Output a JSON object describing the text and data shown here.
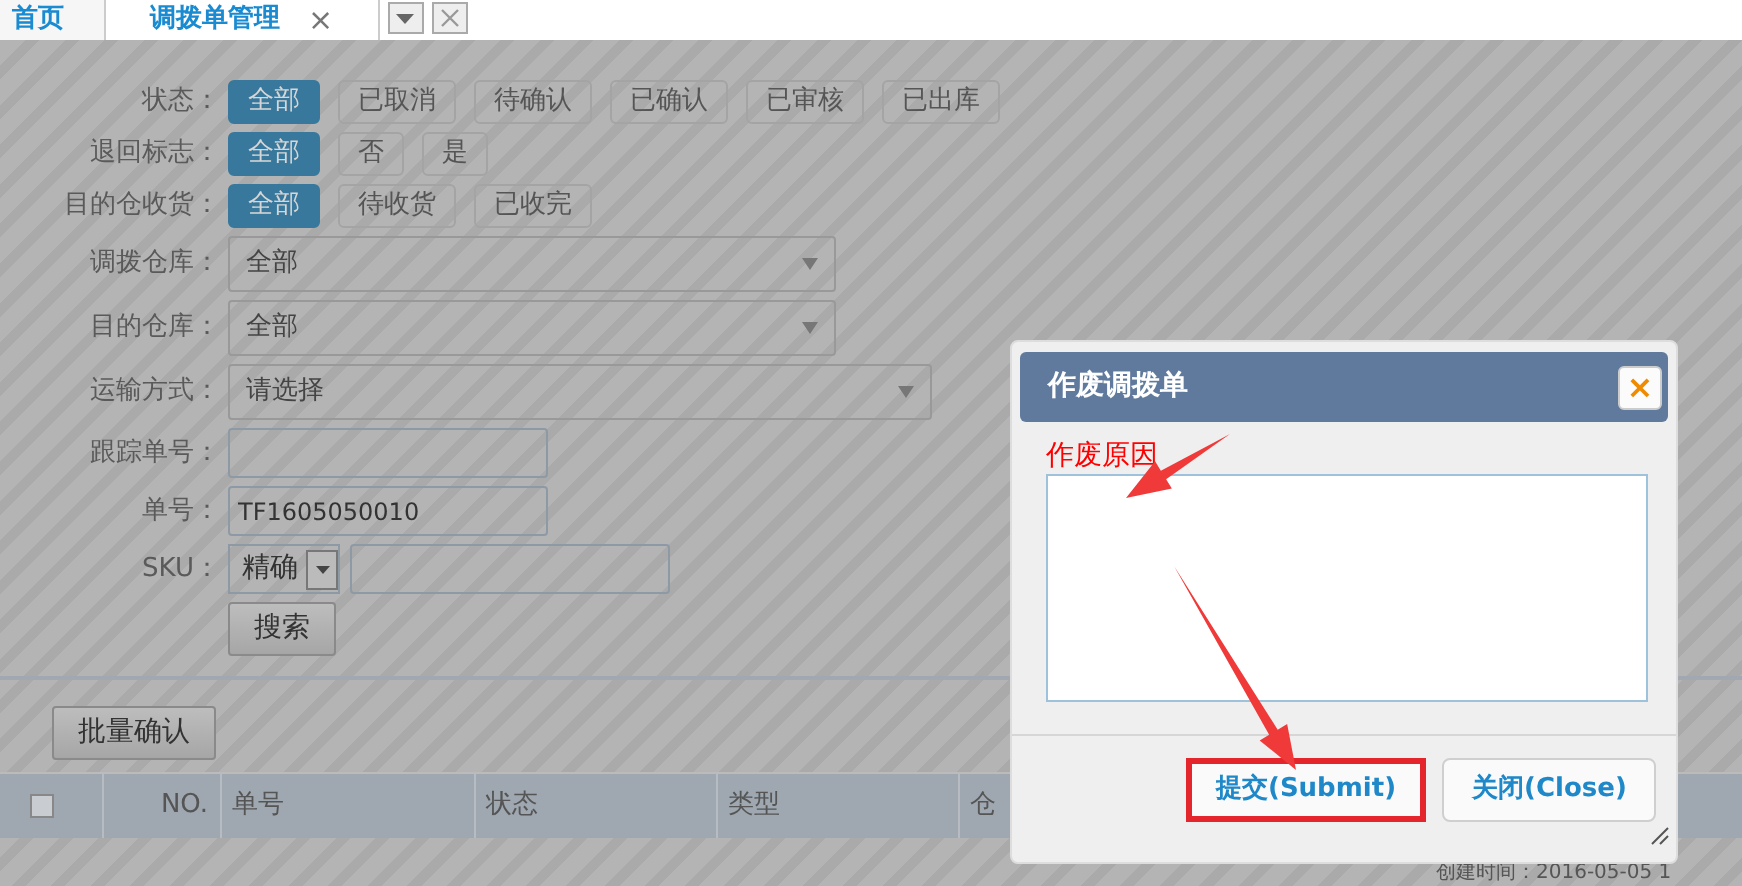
{
  "tabs": [
    {
      "label": "首页",
      "selected": false
    },
    {
      "label": "调拨单管理",
      "selected": true,
      "close": "×"
    }
  ],
  "filters": [
    {
      "kind": "choice",
      "label": "状态：",
      "options": [
        {
          "label": "全部",
          "selected": true
        },
        {
          "label": "已取消",
          "selected": false
        },
        {
          "label": "待确认",
          "selected": false
        },
        {
          "label": "已确认",
          "selected": false
        },
        {
          "label": "已审核",
          "selected": false
        },
        {
          "label": "已出库",
          "selected": false
        }
      ]
    },
    {
      "kind": "choice",
      "label": "退回标志：",
      "options": [
        {
          "label": "全部",
          "selected": true
        },
        {
          "label": "否",
          "selected": false
        },
        {
          "label": "是",
          "selected": false
        }
      ]
    },
    {
      "kind": "choice",
      "label": "目的仓收货：",
      "options": [
        {
          "label": "全部",
          "selected": true
        },
        {
          "label": "待收货",
          "selected": false
        },
        {
          "label": "已收完",
          "selected": false
        }
      ]
    },
    {
      "kind": "select",
      "label": "调拨仓库：",
      "value": "全部"
    },
    {
      "kind": "select",
      "label": "目的仓库：",
      "value": "全部"
    },
    {
      "kind": "select",
      "label": "运输方式：",
      "value": "请选择"
    },
    {
      "kind": "input",
      "label": "跟踪单号："
    },
    {
      "kind": "input",
      "label": "单号：",
      "value": "TF1605050010"
    },
    {
      "kind": "sku",
      "label": "SKU：",
      "value": "精确"
    }
  ],
  "search_button": "搜索",
  "batch_button": "批量确认",
  "table": {
    "header_checkbox": {
      "checked": false
    },
    "columns": [
      "NO.",
      "单号",
      "状态",
      "类型",
      "仓"
    ]
  },
  "footer_text": "创建时间：2016-05-05 1",
  "dialog": {
    "title": "作废调拨单",
    "close": "×",
    "field_label": "作废原因",
    "buttons": [
      {
        "label": "提交(Submit)",
        "highlighted": true
      },
      {
        "label": "关闭(Close)",
        "highlighted": false
      }
    ]
  }
}
